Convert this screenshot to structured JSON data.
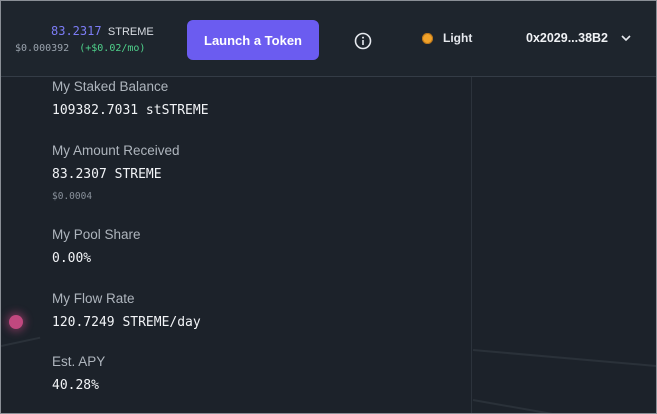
{
  "header": {
    "balance_amount": "83.2317",
    "balance_symbol": "STREME",
    "balance_usd": "$0.000392",
    "balance_change": "(+$0.02/mo)",
    "launch_button": "Launch a Token",
    "theme_label": "Light",
    "wallet_address": "0x2029...38B2",
    "icons": {
      "info": "info-icon",
      "theme": "sun-icon",
      "wallet_menu": "chevron-down-icon"
    }
  },
  "stats": [
    {
      "label": "My Staked Balance",
      "value": "109382.7031 stSTREME"
    },
    {
      "label": "My Amount Received",
      "value": "83.2307 STREME",
      "sub": "$0.0004"
    },
    {
      "label": "My Pool Share",
      "value": "0.00%"
    },
    {
      "label": "My Flow Rate",
      "value": "120.7249 STREME/day"
    },
    {
      "label": "Est. APY",
      "value": "40.28%"
    }
  ],
  "colors": {
    "background": "#1c222a",
    "accent": "#6b5cf0",
    "balance": "#7c7cf5",
    "positive": "#4fd18b",
    "sun": "#f0a22a",
    "dot": "#c1487f"
  }
}
